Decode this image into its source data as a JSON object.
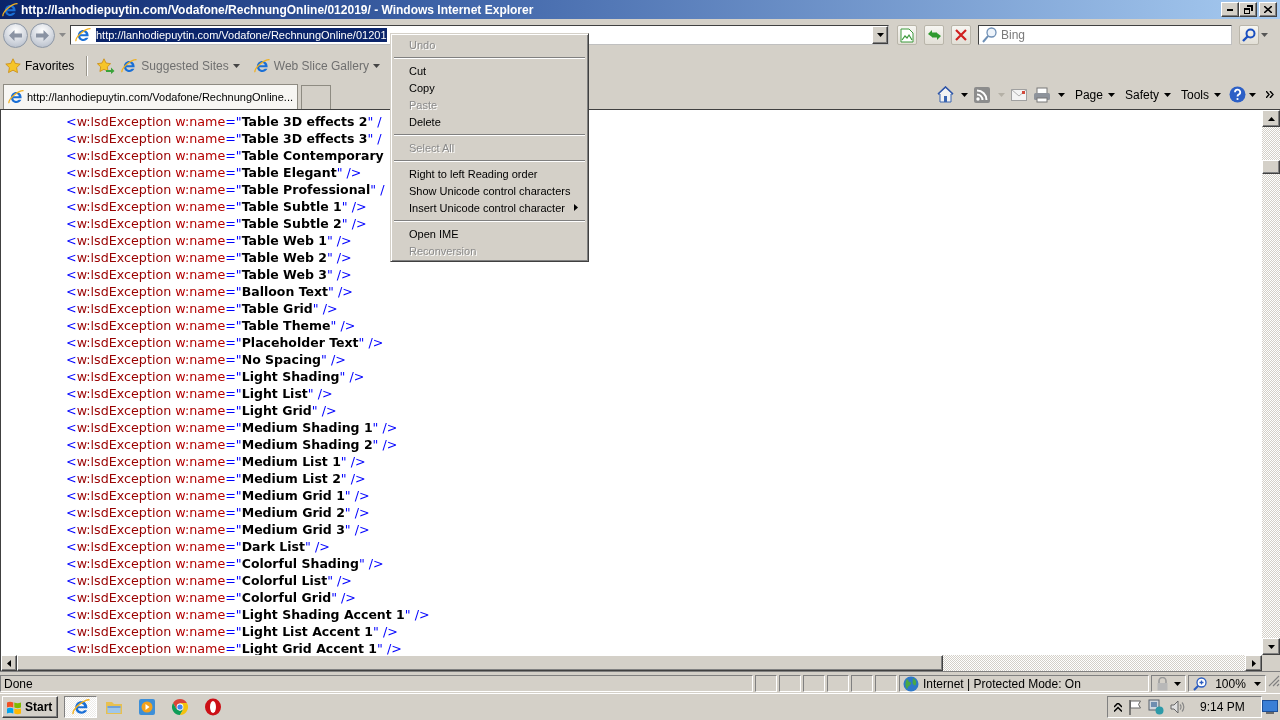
{
  "window": {
    "title": "http://lanhodiepuytin.com/Vodafone/RechnungOnline/012019/ - Windows Internet Explorer"
  },
  "address_bar": {
    "value": "http://lanhodiepuytin.com/Vodafone/RechnungOnline/01201",
    "selected": true
  },
  "search": {
    "placeholder": "Bing"
  },
  "favorites_bar": {
    "favorites": "Favorites",
    "links": [
      {
        "label": "Suggested Sites",
        "disabled": true
      },
      {
        "label": "Web Slice Gallery",
        "disabled": true
      }
    ]
  },
  "tabs": [
    {
      "label": "http://lanhodiepuytin.com/Vodafone/RechnungOnline...",
      "selected": true
    }
  ],
  "command_bar": {
    "menus": [
      "Page",
      "Safety",
      "Tools"
    ]
  },
  "document": {
    "lines": [
      {
        "lt": "<",
        "tag": "w:lsdException",
        "attr": "w:name",
        "eq": "=\"",
        "value": "Table 3D effects 2",
        "end": "\" /"
      },
      {
        "lt": "<",
        "tag": "w:lsdException",
        "attr": "w:name",
        "eq": "=\"",
        "value": "Table 3D effects 3",
        "end": "\" /"
      },
      {
        "lt": "<",
        "tag": "w:lsdException",
        "attr": "w:name",
        "eq": "=\"",
        "value": "Table Contemporary"
      },
      {
        "lt": "<",
        "tag": "w:lsdException",
        "attr": "w:name",
        "eq": "=\"",
        "value": "Table Elegant",
        "end": "\" />"
      },
      {
        "lt": "<",
        "tag": "w:lsdException",
        "attr": "w:name",
        "eq": "=\"",
        "value": "Table Professional",
        "end": "\" /"
      },
      {
        "lt": "<",
        "tag": "w:lsdException",
        "attr": "w:name",
        "eq": "=\"",
        "value": "Table Subtle 1",
        "end": "\" />"
      },
      {
        "lt": "<",
        "tag": "w:lsdException",
        "attr": "w:name",
        "eq": "=\"",
        "value": "Table Subtle 2",
        "end": "\" />"
      },
      {
        "lt": "<",
        "tag": "w:lsdException",
        "attr": "w:name",
        "eq": "=\"",
        "value": "Table Web 1",
        "end": "\" />"
      },
      {
        "lt": "<",
        "tag": "w:lsdException",
        "attr": "w:name",
        "eq": "=\"",
        "value": "Table Web 2",
        "end": "\" />"
      },
      {
        "lt": "<",
        "tag": "w:lsdException",
        "attr": "w:name",
        "eq": "=\"",
        "value": "Table Web 3",
        "end": "\" />"
      },
      {
        "lt": "<",
        "tag": "w:lsdException",
        "attr": "w:name",
        "eq": "=\"",
        "value": "Balloon Text",
        "end": "\" />"
      },
      {
        "lt": "<",
        "tag": "w:lsdException",
        "attr": "w:name",
        "eq": "=\"",
        "value": "Table Grid",
        "end": "\" />"
      },
      {
        "lt": "<",
        "tag": "w:lsdException",
        "attr": "w:name",
        "eq": "=\"",
        "value": "Table Theme",
        "end": "\" />"
      },
      {
        "lt": "<",
        "tag": "w:lsdException",
        "attr": "w:name",
        "eq": "=\"",
        "value": "Placeholder Text",
        "end": "\" />"
      },
      {
        "lt": "<",
        "tag": "w:lsdException",
        "attr": "w:name",
        "eq": "=\"",
        "value": "No Spacing",
        "end": "\" />"
      },
      {
        "lt": "<",
        "tag": "w:lsdException",
        "attr": "w:name",
        "eq": "=\"",
        "value": "Light Shading",
        "end": "\" />"
      },
      {
        "lt": "<",
        "tag": "w:lsdException",
        "attr": "w:name",
        "eq": "=\"",
        "value": "Light List",
        "end": "\" />"
      },
      {
        "lt": "<",
        "tag": "w:lsdException",
        "attr": "w:name",
        "eq": "=\"",
        "value": "Light Grid",
        "end": "\" />"
      },
      {
        "lt": "<",
        "tag": "w:lsdException",
        "attr": "w:name",
        "eq": "=\"",
        "value": "Medium Shading 1",
        "end": "\" />"
      },
      {
        "lt": "<",
        "tag": "w:lsdException",
        "attr": "w:name",
        "eq": "=\"",
        "value": "Medium Shading 2",
        "end": "\" />"
      },
      {
        "lt": "<",
        "tag": "w:lsdException",
        "attr": "w:name",
        "eq": "=\"",
        "value": "Medium List 1",
        "end": "\" />"
      },
      {
        "lt": "<",
        "tag": "w:lsdException",
        "attr": "w:name",
        "eq": "=\"",
        "value": "Medium List 2",
        "end": "\" />"
      },
      {
        "lt": "<",
        "tag": "w:lsdException",
        "attr": "w:name",
        "eq": "=\"",
        "value": "Medium Grid 1",
        "end": "\" />"
      },
      {
        "lt": "<",
        "tag": "w:lsdException",
        "attr": "w:name",
        "eq": "=\"",
        "value": "Medium Grid 2",
        "end": "\" />"
      },
      {
        "lt": "<",
        "tag": "w:lsdException",
        "attr": "w:name",
        "eq": "=\"",
        "value": "Medium Grid 3",
        "end": "\" />"
      },
      {
        "lt": "<",
        "tag": "w:lsdException",
        "attr": "w:name",
        "eq": "=\"",
        "value": "Dark List",
        "end": "\" />"
      },
      {
        "lt": "<",
        "tag": "w:lsdException",
        "attr": "w:name",
        "eq": "=\"",
        "value": "Colorful Shading",
        "end": "\" />"
      },
      {
        "lt": "<",
        "tag": "w:lsdException",
        "attr": "w:name",
        "eq": "=\"",
        "value": "Colorful List",
        "end": "\" />"
      },
      {
        "lt": "<",
        "tag": "w:lsdException",
        "attr": "w:name",
        "eq": "=\"",
        "value": "Colorful Grid",
        "end": "\" />"
      },
      {
        "lt": "<",
        "tag": "w:lsdException",
        "attr": "w:name",
        "eq": "=\"",
        "value": "Light Shading Accent 1",
        "end": "\" />"
      },
      {
        "lt": "<",
        "tag": "w:lsdException",
        "attr": "w:name",
        "eq": "=\"",
        "value": "Light List Accent 1",
        "end": "\" />"
      },
      {
        "lt": "<",
        "tag": "w:lsdException",
        "attr": "w:name",
        "eq": "=\"",
        "value": "Light Grid Accent 1",
        "end": "\" />"
      }
    ]
  },
  "context_menu": {
    "items": [
      {
        "kind": "item",
        "label": "Undo",
        "disabled": true
      },
      {
        "kind": "separator"
      },
      {
        "kind": "item",
        "label": "Cut",
        "disabled": false
      },
      {
        "kind": "item",
        "label": "Copy",
        "disabled": false
      },
      {
        "kind": "item",
        "label": "Paste",
        "disabled": true
      },
      {
        "kind": "item",
        "label": "Delete",
        "disabled": false
      },
      {
        "kind": "separator"
      },
      {
        "kind": "item",
        "label": "Select All",
        "disabled": true
      },
      {
        "kind": "separator"
      },
      {
        "kind": "item",
        "label": "Right to left Reading order",
        "disabled": false
      },
      {
        "kind": "item",
        "label": "Show Unicode control characters",
        "disabled": false
      },
      {
        "kind": "submenu",
        "label": "Insert Unicode control character",
        "disabled": false
      },
      {
        "kind": "separator"
      },
      {
        "kind": "item",
        "label": "Open IME",
        "disabled": false
      },
      {
        "kind": "item",
        "label": "Reconversion",
        "disabled": true
      }
    ]
  },
  "status_bar": {
    "text": "Done",
    "zone": "Internet | Protected Mode: On",
    "zoom": "100%"
  },
  "taskbar": {
    "start": "Start",
    "apps": [
      {
        "kind": "ie",
        "selected": true
      },
      {
        "kind": "explorer",
        "selected": false
      },
      {
        "kind": "media",
        "selected": false
      },
      {
        "kind": "chrome",
        "selected": false
      },
      {
        "kind": "opera",
        "selected": false
      }
    ],
    "clock": "9:14 PM"
  }
}
